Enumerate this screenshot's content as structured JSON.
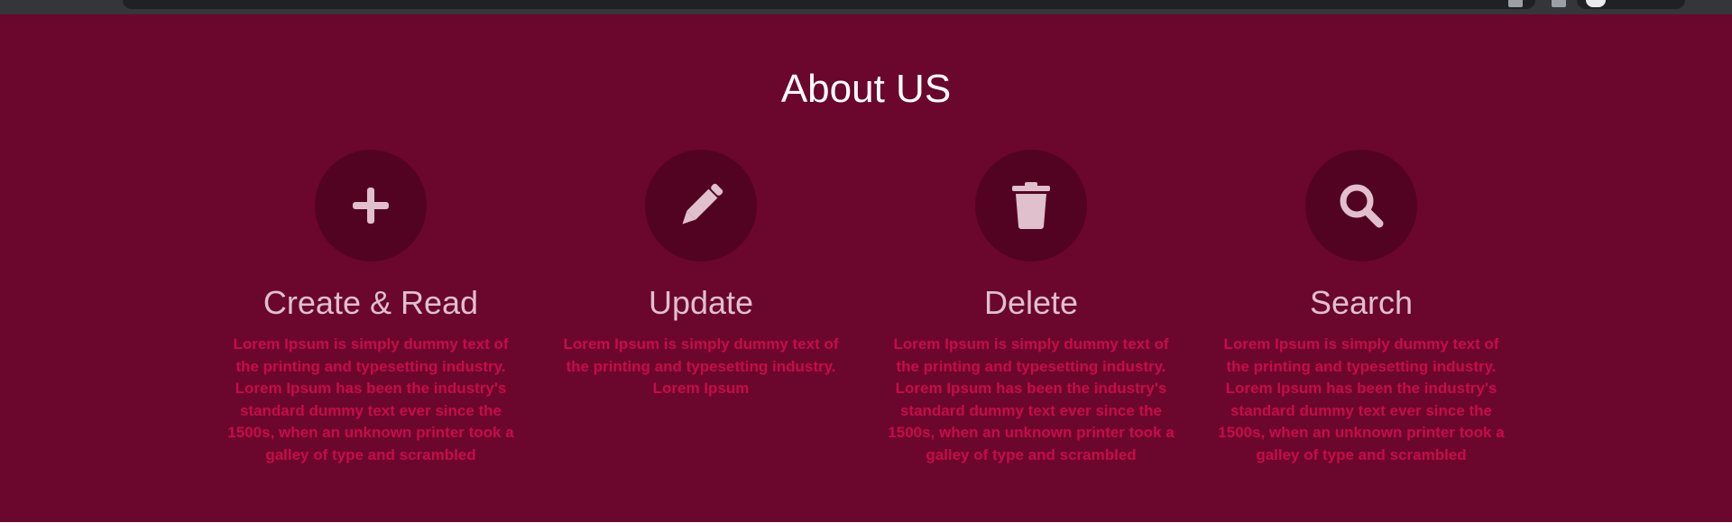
{
  "about": {
    "title": "About US",
    "features": [
      {
        "icon": "plus-icon",
        "title": "Create & Read",
        "text": "Lorem Ipsum is simply dummy text of the printing and typesetting industry. Lorem Ipsum has been the industry's standard dummy text ever since the 1500s, when an unknown printer took a galley of type and scrambled"
      },
      {
        "icon": "pencil-icon",
        "title": "Update",
        "text": "Lorem Ipsum is simply dummy text of the printing and typesetting industry. Lorem Ipsum"
      },
      {
        "icon": "trash-icon",
        "title": "Delete",
        "text": "Lorem Ipsum is simply dummy text of the printing and typesetting industry. Lorem Ipsum has been the industry's standard dummy text ever since the 1500s, when an unknown printer took a galley of type and scrambled"
      },
      {
        "icon": "search-icon",
        "title": "Search",
        "text": "Lorem Ipsum is simply dummy text of the printing and typesetting industry. Lorem Ipsum has been the industry's standard dummy text ever since the 1500s, when an unknown printer took a galley of type and scrambled"
      }
    ]
  },
  "colors": {
    "section_background": "#6b062d",
    "icon_circle": "#530322",
    "icon_glyph": "#dfc0cc",
    "feature_title": "#dfc0cc",
    "feature_text": "#c70c47",
    "section_title": "#ffffff"
  }
}
